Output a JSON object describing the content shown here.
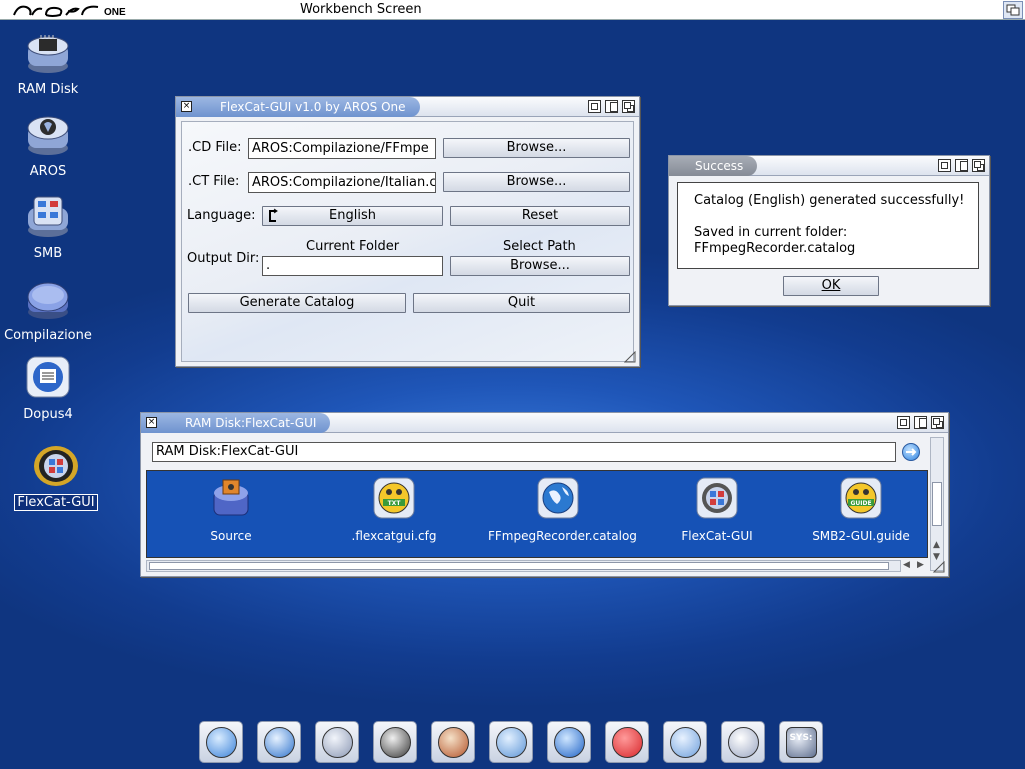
{
  "screen": {
    "logo_text": "arosone",
    "title": "Workbench Screen"
  },
  "desktop_icons": [
    {
      "label": "RAM Disk"
    },
    {
      "label": "AROS"
    },
    {
      "label": "SMB"
    },
    {
      "label": "Compilazione"
    },
    {
      "label": "Dopus4"
    },
    {
      "label": "FlexCat-GUI"
    }
  ],
  "flexcat_window": {
    "title": "FlexCat-GUI v1.0 by AROS One",
    "cd_label": ".CD File:",
    "cd_value": "AROS:Compilazione/FFmpe",
    "ct_label": ".CT File:",
    "ct_value": "AROS:Compilazione/Italian.c",
    "browse_label": "Browse...",
    "language_label": "Language:",
    "language_value": "English",
    "reset_label": "Reset",
    "output_label": "Output Dir:",
    "current_folder_label": "Current Folder",
    "current_folder_value": ".",
    "select_path_label": "Select Path",
    "generate_label": "Generate Catalog",
    "quit_label": "Quit"
  },
  "success_window": {
    "title": "Success",
    "line1": "Catalog (English) generated successfully!",
    "line2": "Saved in current folder:",
    "line3": "FFmpegRecorder.catalog",
    "ok_label": "OK"
  },
  "ramdisk_window": {
    "title": "RAM Disk:FlexCat-GUI",
    "path_value": "RAM Disk:FlexCat-GUI",
    "files": [
      {
        "label": "Source"
      },
      {
        "label": ".flexcatgui.cfg",
        "icon_text": "TXT"
      },
      {
        "label": "FFmpegRecorder.catalog"
      },
      {
        "label": "FlexCat-GUI"
      },
      {
        "label": "SMB2-GUI.guide",
        "icon_text": "GUIDE"
      }
    ]
  },
  "dock": [
    {
      "icon": "magnifier-icon"
    },
    {
      "icon": "display-icon"
    },
    {
      "icon": "search-settings-icon"
    },
    {
      "icon": "multimedia-icon"
    },
    {
      "icon": "tribal-mask-icon"
    },
    {
      "icon": "monitor-icon"
    },
    {
      "icon": "refresh-icon"
    },
    {
      "icon": "power-icon"
    },
    {
      "icon": "shell-icon"
    },
    {
      "icon": "mascot-icon"
    },
    {
      "icon": "sys-icon",
      "text": "SYS:"
    }
  ],
  "colors": {
    "accent": "#6f93cf",
    "desktop": "#1f56b8",
    "icon_area": "#1652b6",
    "power": "#d8272b"
  }
}
